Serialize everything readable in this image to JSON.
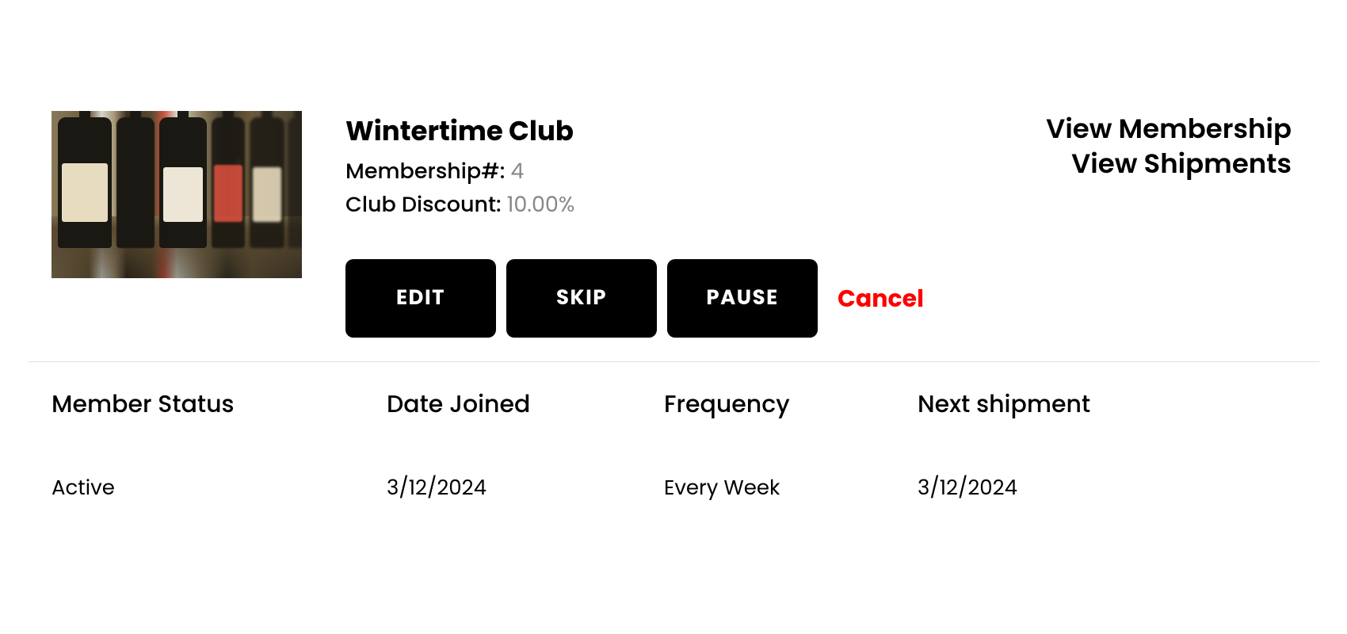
{
  "club": {
    "name": "Wintertime Club",
    "membership_label": "Membership#: ",
    "membership_number": "4",
    "discount_label": "Club Discount: ",
    "discount_value": "10.00%"
  },
  "actions": {
    "edit": "EDIT",
    "skip": "SKIP",
    "pause": "PAUSE",
    "cancel": "Cancel"
  },
  "links": {
    "view_membership": "View Membership",
    "view_shipments": "View Shipments"
  },
  "details": {
    "status_label": "Member Status",
    "status_value": "Active",
    "joined_label": "Date Joined",
    "joined_value": "3/12/2024",
    "frequency_label": "Frequency",
    "frequency_value": "Every Week",
    "next_label": "Next shipment",
    "next_value": "3/12/2024"
  }
}
